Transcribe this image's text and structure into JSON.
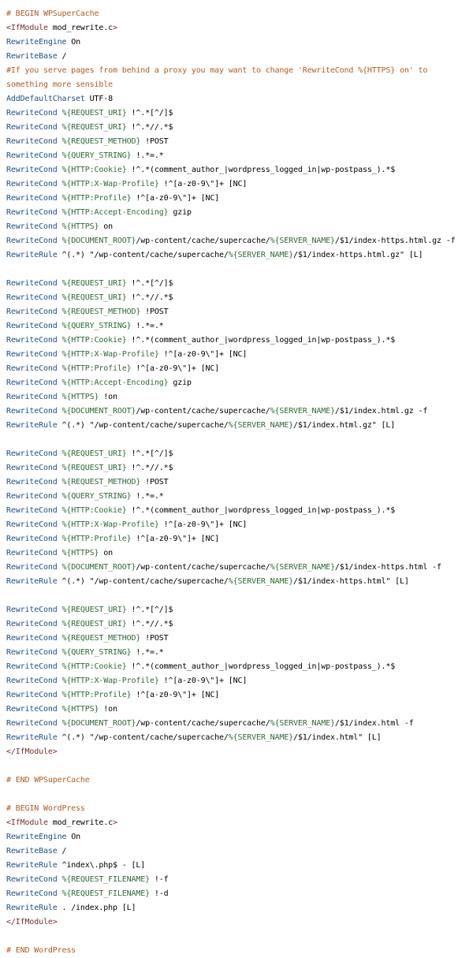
{
  "code": {
    "lines": [
      [
        {
          "t": "# BEGIN WPSuperCache",
          "k": "comment"
        }
      ],
      [
        {
          "t": "<IfModule",
          "k": "tag"
        },
        {
          "t": " mod_rewrite.c",
          "k": "plain"
        },
        {
          "t": ">",
          "k": "tag"
        }
      ],
      [
        {
          "t": "RewriteEngine",
          "k": "directive"
        },
        {
          "t": " On",
          "k": "plain"
        }
      ],
      [
        {
          "t": "RewriteBase",
          "k": "directive"
        },
        {
          "t": " /",
          "k": "plain"
        }
      ],
      [
        {
          "t": "#If you serve pages from behind a proxy you may want to change 'RewriteCond %{HTTPS} on' to",
          "k": "comment"
        }
      ],
      [
        {
          "t": "something more sensible",
          "k": "comment"
        }
      ],
      [
        {
          "t": "AddDefaultCharset",
          "k": "directive"
        },
        {
          "t": " UTF-8",
          "k": "plain"
        }
      ],
      [
        {
          "t": "RewriteCond",
          "k": "directive"
        },
        {
          "t": " %{REQUEST_URI}",
          "k": "var"
        },
        {
          "t": " !^.*[^/]$",
          "k": "plain"
        }
      ],
      [
        {
          "t": "RewriteCond",
          "k": "directive"
        },
        {
          "t": " %{REQUEST_URI}",
          "k": "var"
        },
        {
          "t": " !^.*//.*$",
          "k": "plain"
        }
      ],
      [
        {
          "t": "RewriteCond",
          "k": "directive"
        },
        {
          "t": " %{REQUEST_METHOD}",
          "k": "var"
        },
        {
          "t": " !POST",
          "k": "plain"
        }
      ],
      [
        {
          "t": "RewriteCond",
          "k": "directive"
        },
        {
          "t": " %{QUERY_STRING}",
          "k": "var"
        },
        {
          "t": " !.*=.*",
          "k": "plain"
        }
      ],
      [
        {
          "t": "RewriteCond",
          "k": "directive"
        },
        {
          "t": " %{HTTP:Cookie}",
          "k": "var"
        },
        {
          "t": " !^.*(comment_author_|wordpress_logged_in|wp-postpass_).*$",
          "k": "plain"
        }
      ],
      [
        {
          "t": "RewriteCond",
          "k": "directive"
        },
        {
          "t": " %{HTTP:X-Wap-Profile}",
          "k": "var"
        },
        {
          "t": " !^[a-z0-9\\\"]+ [NC]",
          "k": "plain"
        }
      ],
      [
        {
          "t": "RewriteCond",
          "k": "directive"
        },
        {
          "t": " %{HTTP:Profile}",
          "k": "var"
        },
        {
          "t": " !^[a-z0-9\\\"]+ [NC]",
          "k": "plain"
        }
      ],
      [
        {
          "t": "RewriteCond",
          "k": "directive"
        },
        {
          "t": " %{HTTP:Accept-Encoding}",
          "k": "var"
        },
        {
          "t": " gzip",
          "k": "plain"
        }
      ],
      [
        {
          "t": "RewriteCond",
          "k": "directive"
        },
        {
          "t": " %{HTTPS}",
          "k": "var"
        },
        {
          "t": " on",
          "k": "plain"
        }
      ],
      [
        {
          "t": "RewriteCond",
          "k": "directive"
        },
        {
          "t": " %{DOCUMENT_ROOT}",
          "k": "var"
        },
        {
          "t": "/wp-content/cache/supercache/",
          "k": "plain"
        },
        {
          "t": "%{SERVER_NAME}",
          "k": "var"
        },
        {
          "t": "/$1/index-https.html.gz -f",
          "k": "plain"
        }
      ],
      [
        {
          "t": "RewriteRule",
          "k": "directive"
        },
        {
          "t": " ^(.*) \"/wp-content/cache/supercache/",
          "k": "plain"
        },
        {
          "t": "%{SERVER_NAME}",
          "k": "var"
        },
        {
          "t": "/$1/index-https.html.gz\" [L]",
          "k": "plain"
        }
      ],
      [],
      [
        {
          "t": "RewriteCond",
          "k": "directive"
        },
        {
          "t": " %{REQUEST_URI}",
          "k": "var"
        },
        {
          "t": " !^.*[^/]$",
          "k": "plain"
        }
      ],
      [
        {
          "t": "RewriteCond",
          "k": "directive"
        },
        {
          "t": " %{REQUEST_URI}",
          "k": "var"
        },
        {
          "t": " !^.*//.*$",
          "k": "plain"
        }
      ],
      [
        {
          "t": "RewriteCond",
          "k": "directive"
        },
        {
          "t": " %{REQUEST_METHOD}",
          "k": "var"
        },
        {
          "t": " !POST",
          "k": "plain"
        }
      ],
      [
        {
          "t": "RewriteCond",
          "k": "directive"
        },
        {
          "t": " %{QUERY_STRING}",
          "k": "var"
        },
        {
          "t": " !.*=.*",
          "k": "plain"
        }
      ],
      [
        {
          "t": "RewriteCond",
          "k": "directive"
        },
        {
          "t": " %{HTTP:Cookie}",
          "k": "var"
        },
        {
          "t": " !^.*(comment_author_|wordpress_logged_in|wp-postpass_).*$",
          "k": "plain"
        }
      ],
      [
        {
          "t": "RewriteCond",
          "k": "directive"
        },
        {
          "t": " %{HTTP:X-Wap-Profile}",
          "k": "var"
        },
        {
          "t": " !^[a-z0-9\\\"]+ [NC]",
          "k": "plain"
        }
      ],
      [
        {
          "t": "RewriteCond",
          "k": "directive"
        },
        {
          "t": " %{HTTP:Profile}",
          "k": "var"
        },
        {
          "t": " !^[a-z0-9\\\"]+ [NC]",
          "k": "plain"
        }
      ],
      [
        {
          "t": "RewriteCond",
          "k": "directive"
        },
        {
          "t": " %{HTTP:Accept-Encoding}",
          "k": "var"
        },
        {
          "t": " gzip",
          "k": "plain"
        }
      ],
      [
        {
          "t": "RewriteCond",
          "k": "directive"
        },
        {
          "t": " %{HTTPS}",
          "k": "var"
        },
        {
          "t": " !on",
          "k": "plain"
        }
      ],
      [
        {
          "t": "RewriteCond",
          "k": "directive"
        },
        {
          "t": " %{DOCUMENT_ROOT}",
          "k": "var"
        },
        {
          "t": "/wp-content/cache/supercache/",
          "k": "plain"
        },
        {
          "t": "%{SERVER_NAME}",
          "k": "var"
        },
        {
          "t": "/$1/index.html.gz -f",
          "k": "plain"
        }
      ],
      [
        {
          "t": "RewriteRule",
          "k": "directive"
        },
        {
          "t": " ^(.*) \"/wp-content/cache/supercache/",
          "k": "plain"
        },
        {
          "t": "%{SERVER_NAME}",
          "k": "var"
        },
        {
          "t": "/$1/index.html.gz\" [L]",
          "k": "plain"
        }
      ],
      [],
      [
        {
          "t": "RewriteCond",
          "k": "directive"
        },
        {
          "t": " %{REQUEST_URI}",
          "k": "var"
        },
        {
          "t": " !^.*[^/]$",
          "k": "plain"
        }
      ],
      [
        {
          "t": "RewriteCond",
          "k": "directive"
        },
        {
          "t": " %{REQUEST_URI}",
          "k": "var"
        },
        {
          "t": " !^.*//.*$",
          "k": "plain"
        }
      ],
      [
        {
          "t": "RewriteCond",
          "k": "directive"
        },
        {
          "t": " %{REQUEST_METHOD}",
          "k": "var"
        },
        {
          "t": " !POST",
          "k": "plain"
        }
      ],
      [
        {
          "t": "RewriteCond",
          "k": "directive"
        },
        {
          "t": " %{QUERY_STRING}",
          "k": "var"
        },
        {
          "t": " !.*=.*",
          "k": "plain"
        }
      ],
      [
        {
          "t": "RewriteCond",
          "k": "directive"
        },
        {
          "t": " %{HTTP:Cookie}",
          "k": "var"
        },
        {
          "t": " !^.*(comment_author_|wordpress_logged_in|wp-postpass_).*$",
          "k": "plain"
        }
      ],
      [
        {
          "t": "RewriteCond",
          "k": "directive"
        },
        {
          "t": " %{HTTP:X-Wap-Profile}",
          "k": "var"
        },
        {
          "t": " !^[a-z0-9\\\"]+ [NC]",
          "k": "plain"
        }
      ],
      [
        {
          "t": "RewriteCond",
          "k": "directive"
        },
        {
          "t": " %{HTTP:Profile}",
          "k": "var"
        },
        {
          "t": " !^[a-z0-9\\\"]+ [NC]",
          "k": "plain"
        }
      ],
      [
        {
          "t": "RewriteCond",
          "k": "directive"
        },
        {
          "t": " %{HTTPS}",
          "k": "var"
        },
        {
          "t": " on",
          "k": "plain"
        }
      ],
      [
        {
          "t": "RewriteCond",
          "k": "directive"
        },
        {
          "t": " %{DOCUMENT_ROOT}",
          "k": "var"
        },
        {
          "t": "/wp-content/cache/supercache/",
          "k": "plain"
        },
        {
          "t": "%{SERVER_NAME}",
          "k": "var"
        },
        {
          "t": "/$1/index-https.html -f",
          "k": "plain"
        }
      ],
      [
        {
          "t": "RewriteRule",
          "k": "directive"
        },
        {
          "t": " ^(.*) \"/wp-content/cache/supercache/",
          "k": "plain"
        },
        {
          "t": "%{SERVER_NAME}",
          "k": "var"
        },
        {
          "t": "/$1/index-https.html\" [L]",
          "k": "plain"
        }
      ],
      [],
      [
        {
          "t": "RewriteCond",
          "k": "directive"
        },
        {
          "t": " %{REQUEST_URI}",
          "k": "var"
        },
        {
          "t": " !^.*[^/]$",
          "k": "plain"
        }
      ],
      [
        {
          "t": "RewriteCond",
          "k": "directive"
        },
        {
          "t": " %{REQUEST_URI}",
          "k": "var"
        },
        {
          "t": " !^.*//.*$",
          "k": "plain"
        }
      ],
      [
        {
          "t": "RewriteCond",
          "k": "directive"
        },
        {
          "t": " %{REQUEST_METHOD}",
          "k": "var"
        },
        {
          "t": " !POST",
          "k": "plain"
        }
      ],
      [
        {
          "t": "RewriteCond",
          "k": "directive"
        },
        {
          "t": " %{QUERY_STRING}",
          "k": "var"
        },
        {
          "t": " !.*=.*",
          "k": "plain"
        }
      ],
      [
        {
          "t": "RewriteCond",
          "k": "directive"
        },
        {
          "t": " %{HTTP:Cookie}",
          "k": "var"
        },
        {
          "t": " !^.*(comment_author_|wordpress_logged_in|wp-postpass_).*$",
          "k": "plain"
        }
      ],
      [
        {
          "t": "RewriteCond",
          "k": "directive"
        },
        {
          "t": " %{HTTP:X-Wap-Profile}",
          "k": "var"
        },
        {
          "t": " !^[a-z0-9\\\"]+ [NC]",
          "k": "plain"
        }
      ],
      [
        {
          "t": "RewriteCond",
          "k": "directive"
        },
        {
          "t": " %{HTTP:Profile}",
          "k": "var"
        },
        {
          "t": " !^[a-z0-9\\\"]+ [NC]",
          "k": "plain"
        }
      ],
      [
        {
          "t": "RewriteCond",
          "k": "directive"
        },
        {
          "t": " %{HTTPS}",
          "k": "var"
        },
        {
          "t": " !on",
          "k": "plain"
        }
      ],
      [
        {
          "t": "RewriteCond",
          "k": "directive"
        },
        {
          "t": " %{DOCUMENT_ROOT}",
          "k": "var"
        },
        {
          "t": "/wp-content/cache/supercache/",
          "k": "plain"
        },
        {
          "t": "%{SERVER_NAME}",
          "k": "var"
        },
        {
          "t": "/$1/index.html -f",
          "k": "plain"
        }
      ],
      [
        {
          "t": "RewriteRule",
          "k": "directive"
        },
        {
          "t": " ^(.*) \"/wp-content/cache/supercache/",
          "k": "plain"
        },
        {
          "t": "%{SERVER_NAME}",
          "k": "var"
        },
        {
          "t": "/$1/index.html\" [L]",
          "k": "plain"
        }
      ],
      [
        {
          "t": "</IfModule>",
          "k": "tag"
        }
      ],
      [],
      [
        {
          "t": "# END WPSuperCache",
          "k": "comment"
        }
      ],
      [],
      [
        {
          "t": "# BEGIN WordPress",
          "k": "comment"
        }
      ],
      [
        {
          "t": "<IfModule",
          "k": "tag"
        },
        {
          "t": " mod_rewrite.c",
          "k": "plain"
        },
        {
          "t": ">",
          "k": "tag"
        }
      ],
      [
        {
          "t": "RewriteEngine",
          "k": "directive"
        },
        {
          "t": " On",
          "k": "plain"
        }
      ],
      [
        {
          "t": "RewriteBase",
          "k": "directive"
        },
        {
          "t": " /",
          "k": "plain"
        }
      ],
      [
        {
          "t": "RewriteRule",
          "k": "directive"
        },
        {
          "t": " ^index\\.php$ - [L]",
          "k": "plain"
        }
      ],
      [
        {
          "t": "RewriteCond",
          "k": "directive"
        },
        {
          "t": " %{REQUEST_FILENAME}",
          "k": "var"
        },
        {
          "t": " !-f",
          "k": "plain"
        }
      ],
      [
        {
          "t": "RewriteCond",
          "k": "directive"
        },
        {
          "t": " %{REQUEST_FILENAME}",
          "k": "var"
        },
        {
          "t": " !-d",
          "k": "plain"
        }
      ],
      [
        {
          "t": "RewriteRule",
          "k": "directive"
        },
        {
          "t": " . /index.php [L]",
          "k": "plain"
        }
      ],
      [
        {
          "t": "</IfModule>",
          "k": "tag"
        }
      ],
      [],
      [
        {
          "t": "# END WordPress",
          "k": "comment"
        }
      ]
    ]
  },
  "colors": {
    "comment": "#b35a1f",
    "directive": "#1b4f8a",
    "tag": "#7a2e2e",
    "var": "#2f6b34",
    "plain": "#000000",
    "background": "#ffffff"
  }
}
